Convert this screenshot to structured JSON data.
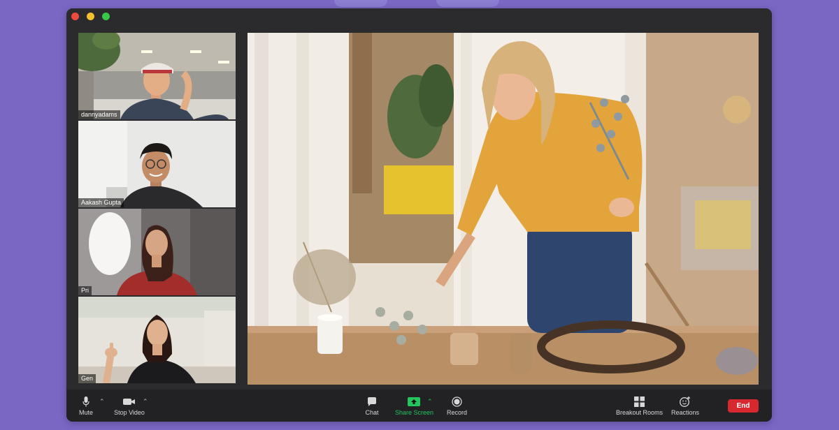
{
  "participants": [
    {
      "name": "dannyadams"
    },
    {
      "name": "Aakash Gupta"
    },
    {
      "name": "Pri"
    },
    {
      "name": "Gen"
    }
  ],
  "toolbar": {
    "mute_label": "Mute",
    "stop_video_label": "Stop Video",
    "chat_label": "Chat",
    "share_screen_label": "Share Screen",
    "record_label": "Record",
    "breakout_rooms_label": "Breakout Rooms",
    "reactions_label": "Reactions",
    "end_label": "End"
  },
  "colors": {
    "background": "#7a67c4",
    "window": "#2b2b2d",
    "toolbar": "#222224",
    "share_accent": "#22c55e",
    "end_button": "#d8282f"
  },
  "icons": [
    "microphone-icon",
    "video-camera-icon",
    "chat-bubble-icon",
    "share-screen-icon",
    "record-icon",
    "breakout-rooms-icon",
    "reactions-icon"
  ]
}
